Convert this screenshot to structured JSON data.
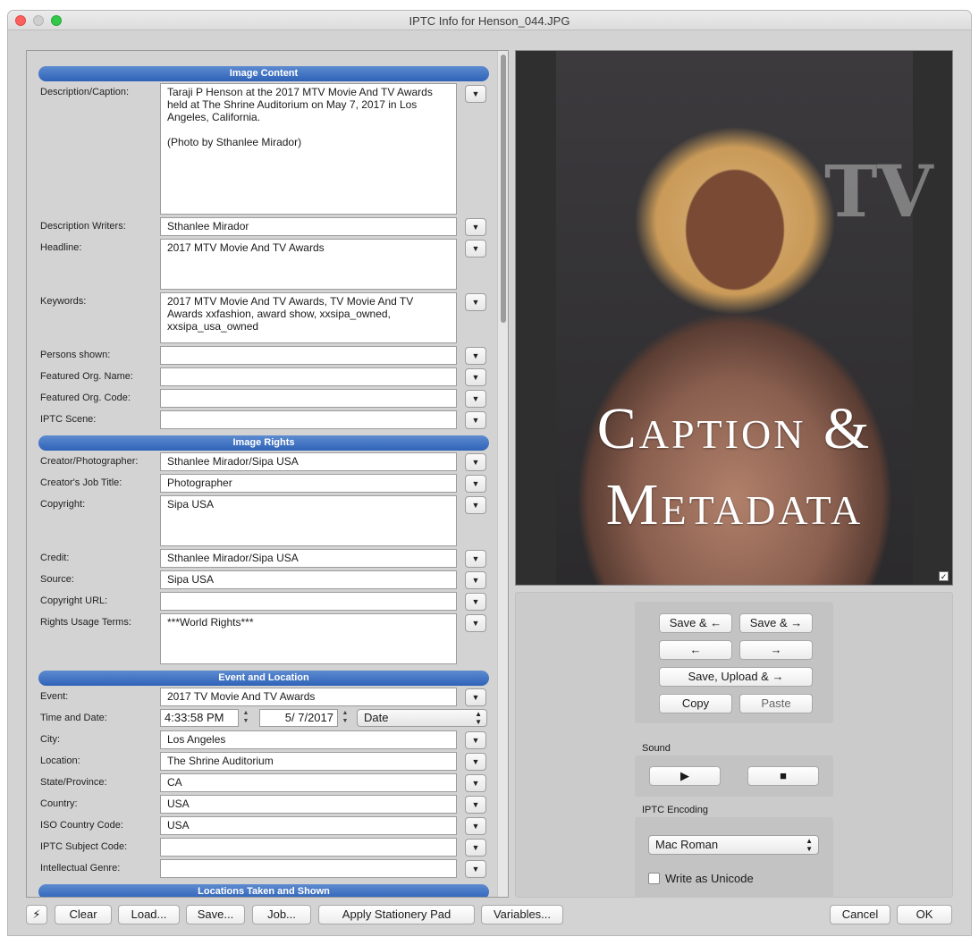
{
  "window": {
    "title": "IPTC Info for Henson_044.JPG"
  },
  "sections": {
    "image_content": "Image Content",
    "image_rights": "Image Rights",
    "event_location": "Event and Location",
    "locations_taken": "Locations Taken and Shown"
  },
  "fields": {
    "description_caption": {
      "label": "Description/Caption:",
      "value": "Taraji P Henson at the 2017 MTV Movie And TV Awards held at The Shrine Auditorium on May 7, 2017 in Los Angeles, California.\n\n(Photo by Sthanlee Mirador)"
    },
    "description_writers": {
      "label": "Description Writers:",
      "value": "Sthanlee Mirador"
    },
    "headline": {
      "label": "Headline:",
      "value": "2017 MTV Movie And TV Awards"
    },
    "keywords": {
      "label": "Keywords:",
      "value": "2017 MTV Movie And TV Awards, TV Movie And TV Awards xxfashion, award show, xxsipa_owned, xxsipa_usa_owned"
    },
    "persons_shown": {
      "label": "Persons shown:",
      "value": ""
    },
    "featured_org_name": {
      "label": "Featured Org. Name:",
      "value": ""
    },
    "featured_org_code": {
      "label": "Featured Org. Code:",
      "value": ""
    },
    "iptc_scene": {
      "label": "IPTC Scene:",
      "value": ""
    },
    "creator": {
      "label": "Creator/Photographer:",
      "value": "Sthanlee Mirador/Sipa USA"
    },
    "creator_job_title": {
      "label": "Creator's Job Title:",
      "value": "Photographer"
    },
    "copyright": {
      "label": "Copyright:",
      "value": "Sipa USA"
    },
    "credit": {
      "label": "Credit:",
      "value": "Sthanlee Mirador/Sipa USA"
    },
    "source": {
      "label": "Source:",
      "value": "Sipa USA"
    },
    "copyright_url": {
      "label": "Copyright URL:",
      "value": ""
    },
    "rights_usage_terms": {
      "label": "Rights Usage Terms:",
      "value": "***World Rights***"
    },
    "event": {
      "label": "Event:",
      "value": "2017 TV Movie And TV Awards"
    },
    "time_date": {
      "label": "Time and Date:",
      "time": "4:33:58 PM",
      "date": "5/  7/2017",
      "mode": "Date"
    },
    "city": {
      "label": "City:",
      "value": "Los Angeles"
    },
    "location": {
      "label": "Location:",
      "value": "The Shrine Auditorium"
    },
    "state": {
      "label": "State/Province:",
      "value": "CA"
    },
    "country": {
      "label": "Country:",
      "value": "USA"
    },
    "iso_country": {
      "label": "ISO Country Code:",
      "value": "USA"
    },
    "iptc_subject": {
      "label": "IPTC Subject Code:",
      "value": ""
    },
    "intellectual_genre": {
      "label": "Intellectual Genre:",
      "value": ""
    }
  },
  "preview": {
    "overlay_line1": "Caption &",
    "overlay_line2": "Metadata"
  },
  "nav": {
    "save_prev": "Save & ←",
    "save_next": "Save & →",
    "prev": "←",
    "next": "→",
    "save_upload_next": "Save, Upload & →",
    "copy": "Copy",
    "paste": "Paste"
  },
  "sound": {
    "label": "Sound",
    "play": "▶",
    "stop": "■"
  },
  "encoding": {
    "label": "IPTC Encoding",
    "value": "Mac Roman",
    "unicode_label": "Write as Unicode"
  },
  "footer": {
    "flash": "⚡",
    "clear": "Clear",
    "load": "Load...",
    "save": "Save...",
    "job": "Job...",
    "apply_stationery": "Apply Stationery Pad",
    "variables": "Variables...",
    "cancel": "Cancel",
    "ok": "OK"
  }
}
